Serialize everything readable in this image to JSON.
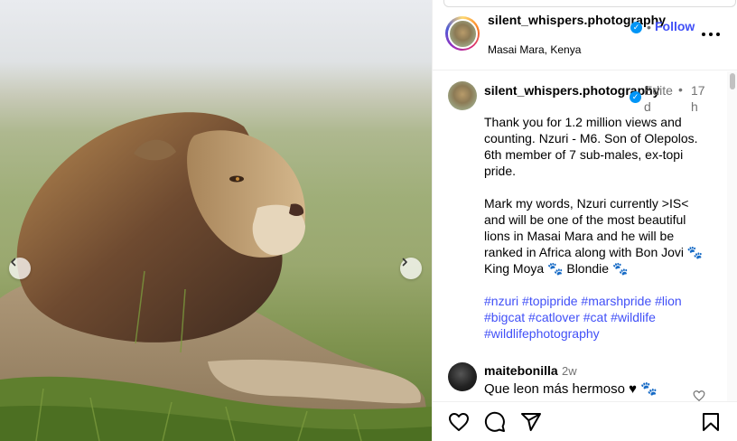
{
  "post": {
    "username": "silent_whispers.photography",
    "location": "Masai Mara, Kenya",
    "follow_label": "Follow",
    "dot": "•"
  },
  "caption": {
    "username": "silent_whispers.photography",
    "edited": "Edited",
    "separator": "•",
    "time": "17h",
    "text": "Thank you for 1.2 million views and counting. Nzuri - M6. Son of Olepolos. 6th member of 7 sub-males, ex-topi pride.\n\nMark my words, Nzuri currently >IS< and will be one of the most beautiful lions in Masai Mara and he will be ranked in Africa along with Bon Jovi 🐾 King Moya 🐾 Blondie 🐾",
    "hashtags": [
      "#nzuri",
      "#topipride",
      "#marshpride",
      "#lion",
      "#bigcat",
      "#catlover",
      "#cat",
      "#wildlife",
      "#wildlifephotography"
    ]
  },
  "comment": {
    "username": "maitebonilla",
    "time": "2w",
    "text": "Que leon más hermoso ♥ 🐾"
  },
  "icons": {
    "prev": "chevron-left-icon",
    "next": "chevron-right-icon",
    "verified": "verified-badge-icon",
    "more": "more-options-icon",
    "like": "heart-icon",
    "comment": "comment-icon",
    "share": "share-icon",
    "save": "bookmark-icon"
  },
  "colors": {
    "link": "#4150f7",
    "verified": "#0095f6",
    "muted": "#737373"
  }
}
